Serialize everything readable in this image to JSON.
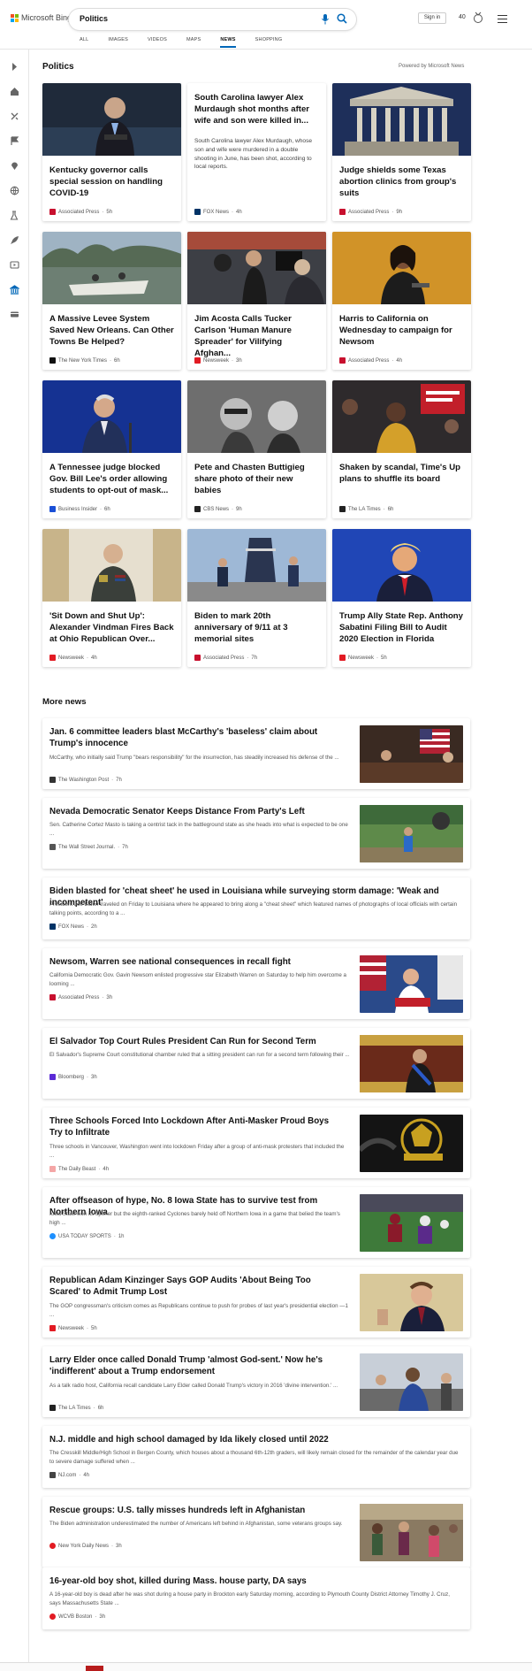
{
  "header": {
    "brand": "Microsoft Bing",
    "search_value": "Politics",
    "signin_label": "Sign in",
    "points": "40",
    "tabs": [
      {
        "label": "ALL"
      },
      {
        "label": "IMAGES"
      },
      {
        "label": "VIDEOS"
      },
      {
        "label": "MAPS"
      },
      {
        "label": "NEWS"
      },
      {
        "label": "SHOPPING"
      }
    ],
    "active_tab": "NEWS",
    "accent": "#0067b8"
  },
  "leftrail": {
    "icons": [
      "expand-icon",
      "home-icon",
      "sports-icon",
      "flag-icon",
      "location-icon",
      "globe-icon",
      "science-icon",
      "rocket-icon",
      "video-icon",
      "business-icon",
      "card-icon"
    ]
  },
  "section": {
    "title": "Politics",
    "powered_by": "Powered by Microsoft News"
  },
  "cards": [
    {
      "title": "Kentucky governor calls special session on handling COVID-19",
      "source": "Associated Press",
      "age": "5h",
      "src_color": "#c8102e"
    },
    {
      "title": "South Carolina lawyer Alex Murdaugh shot months after wife and son were killed in...",
      "snippet": "South Carolina lawyer Alex Murdaugh, whose son and wife were murdered in a double shooting in June, has been shot, according to local reports.",
      "source": "FOX News",
      "age": "4h",
      "src_color": "#003366"
    },
    {
      "title": "Judge shields some Texas abortion clinics from group's suits",
      "source": "Associated Press",
      "age": "9h",
      "src_color": "#c8102e"
    },
    {
      "title": "A Massive Levee System Saved New Orleans. Can Other Towns Be Helped?",
      "source": "The New York Times",
      "age": "6h",
      "src_color": "#111111"
    },
    {
      "title": "Jim Acosta Calls Tucker Carlson 'Human Manure Spreader' for Vilifying Afghan...",
      "source": "Newsweek",
      "age": "3h",
      "src_color": "#e21b23"
    },
    {
      "title": "Harris to California on Wednesday to campaign for Newsom",
      "source": "Associated Press",
      "age": "4h",
      "src_color": "#c8102e"
    },
    {
      "title": "A Tennessee judge blocked Gov. Bill Lee's order allowing students to opt-out of mask...",
      "source": "Business Insider",
      "age": "6h",
      "src_color": "#1a4fd6"
    },
    {
      "title": "Pete and Chasten Buttigieg share photo of their new babies",
      "source": "CBS News",
      "age": "9h",
      "src_color": "#222222"
    },
    {
      "title": "Shaken by scandal, Time's Up plans to shuffle its board",
      "source": "The LA Times",
      "age": "6h",
      "src_color": "#222222"
    },
    {
      "title": "'Sit Down and Shut Up': Alexander Vindman Fires Back at Ohio Republican Over...",
      "source": "Newsweek",
      "age": "4h",
      "src_color": "#e21b23"
    },
    {
      "title": "Biden to mark 20th anniversary of 9/11 at 3 memorial sites",
      "source": "Associated Press",
      "age": "7h",
      "src_color": "#c8102e"
    },
    {
      "title": "Trump Ally State Rep. Anthony Sabatini Filing Bill to Audit 2020 Election in Florida",
      "source": "Newsweek",
      "age": "5h",
      "src_color": "#e21b23"
    }
  ],
  "more_news": {
    "title": "More news",
    "items": [
      {
        "headline": "Jan. 6 committee leaders blast McCarthy's 'baseless' claim about Trump's innocence",
        "snippet": "McCarthy, who initially said Trump \"bears responsibility\" for the insurrection, has steadily increased his defense of the ...",
        "source": "The Washington Post",
        "age": "7h",
        "src_color": "#333333"
      },
      {
        "headline": "Nevada Democratic Senator Keeps Distance From Party's Left",
        "snippet": "Sen. Catherine Cortez Masto is taking a centrist tack in the battleground state as she heads into what is expected to be one ...",
        "source": "The Wall Street Journal.",
        "age": "7h",
        "src_color": "#555555"
      },
      {
        "headline": "Biden blasted for 'cheat sheet' he used in Louisiana while surveying storm damage: 'Weak and incompetent'",
        "snippet": "President Joe Biden traveled on Friday to Louisiana where he appeared to bring along a \"cheat sheet\" which featured names of photographs of local officials with certain talking points, according to a ...",
        "source": "FOX News",
        "age": "2h",
        "src_color": "#003366"
      },
      {
        "headline": "Newsom, Warren see national consequences in recall fight",
        "snippet": "California Democratic Gov. Gavin Newsom enlisted progressive star Elizabeth Warren on Saturday to help him overcome a looming ...",
        "source": "Associated Press",
        "age": "3h",
        "src_color": "#c8102e"
      },
      {
        "headline": "El Salvador Top Court Rules President Can Run for Second Term",
        "snippet": "El Salvador's Supreme Court constitutional chamber ruled that a sitting president can run for a second term following their ...",
        "source": "Bloomberg",
        "age": "3h",
        "src_color": "#5b2bd6"
      },
      {
        "headline": "Three Schools Forced Into Lockdown After Anti-Masker Proud Boys Try to Infiltrate",
        "snippet": "Three schools in Vancouver, Washington went into lockdown Friday after a group of anti-mask protesters that included the ...",
        "source": "The Daily Beast",
        "age": "4h",
        "src_color": "#f4a6a6"
      },
      {
        "headline": "After offseason of hype, No. 8 Iowa State has to survive test from Northern Iowa",
        "snippet": "Iowa State won its opener but the eighth-ranked Cyclones barely held off Northern Iowa in a game that belied the team's high ...",
        "source": "USA TODAY SPORTS",
        "age": "1h",
        "src_color": "#1e90ff"
      },
      {
        "headline": "Republican Adam Kinzinger Says GOP Audits 'About Being Too Scared' to Admit Trump Lost",
        "snippet": "The GOP congressman's criticism comes as Republicans continue to push for probes of last year's presidential election —1 ...",
        "source": "Newsweek",
        "age": "5h",
        "src_color": "#e21b23"
      },
      {
        "headline": "Larry Elder once called Donald Trump 'almost God-sent.' Now he's 'indifferent' about a Trump endorsement",
        "snippet": "As a talk radio host, California recall candidate Larry Elder called Donald Trump's victory in 2016 'divine intervention.' ...",
        "source": "The LA Times",
        "age": "6h",
        "src_color": "#222222"
      },
      {
        "headline": "N.J. middle and high school damaged by Ida likely closed until 2022",
        "snippet": "The Cresskill Middle/High School in Bergen County, which houses about a thousand 6th-12th graders, will likely remain closed for the remainder of the calendar year due to severe damage suffered when ...",
        "source": "NJ.com",
        "age": "4h",
        "src_color": "#444444"
      },
      {
        "headline": "Rescue groups: U.S. tally misses hundreds left in Afghanistan",
        "snippet": "The Biden administration underestimated the number of Americans left behind in Afghanistan, some veterans groups say.",
        "source": "New York Daily News",
        "age": "3h",
        "src_color": "#e21b23"
      },
      {
        "headline": "16-year-old boy shot, killed during Mass. house party, DA says",
        "snippet": "A 16-year-old boy is dead after he was shot during a house party in Brockton early Saturday morning, according to Plymouth County District Attorney Timothy J. Cruz, says Massachusetts State ...",
        "source": "WCVB Boston",
        "age": "3h",
        "src_color": "#e21b23"
      }
    ]
  }
}
